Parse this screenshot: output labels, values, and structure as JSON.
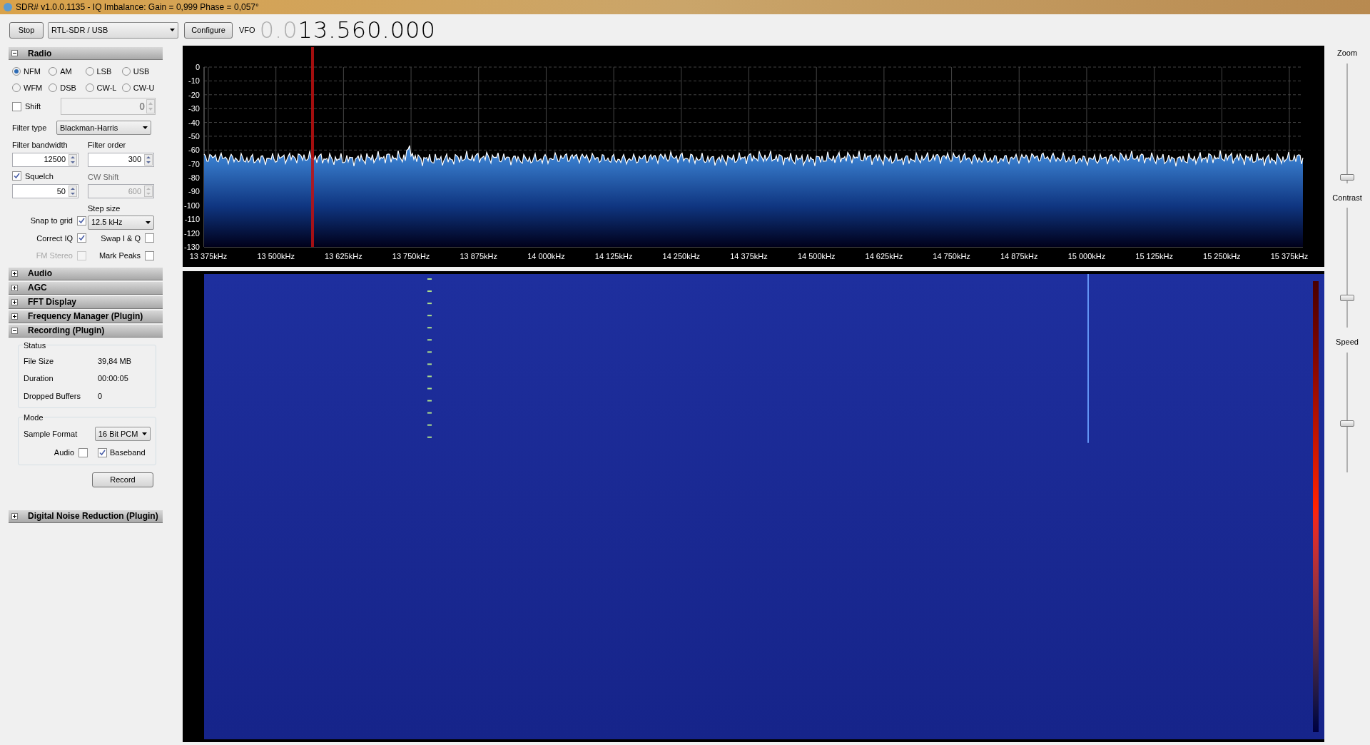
{
  "window": {
    "title": "SDR# v1.0.0.1135 - IQ Imbalance: Gain = 0,999 Phase = 0,057°"
  },
  "toolbar": {
    "stop_button": "Stop",
    "source": "RTL-SDR / USB",
    "configure_button": "Configure",
    "vfo_label": "VFO",
    "vfo_dim": "0.0",
    "vfo_value": "13.560.000"
  },
  "sections": [
    {
      "title": "Radio",
      "expanded": true,
      "kind": "radio"
    },
    {
      "title": "Audio",
      "expanded": false
    },
    {
      "title": "AGC",
      "expanded": false
    },
    {
      "title": "FFT Display",
      "expanded": false
    },
    {
      "title": "Frequency Manager (Plugin)",
      "expanded": false
    },
    {
      "title": "Recording (Plugin)",
      "expanded": true,
      "kind": "recording"
    },
    {
      "title": "Digital Noise Reduction (Plugin)",
      "expanded": false
    }
  ],
  "radio": {
    "modes": [
      {
        "label": "NFM",
        "selected": true
      },
      {
        "label": "AM",
        "selected": false
      },
      {
        "label": "LSB",
        "selected": false
      },
      {
        "label": "USB",
        "selected": false
      },
      {
        "label": "WFM",
        "selected": false
      },
      {
        "label": "DSB",
        "selected": false
      },
      {
        "label": "CW-L",
        "selected": false
      },
      {
        "label": "CW-U",
        "selected": false
      }
    ],
    "shift": {
      "label": "Shift",
      "checked": false,
      "value": "0"
    },
    "filter_type": {
      "label": "Filter type",
      "value": "Blackman-Harris"
    },
    "filter_bandwidth": {
      "label": "Filter bandwidth",
      "value": "12500"
    },
    "filter_order": {
      "label": "Filter order",
      "value": "300"
    },
    "squelch": {
      "label": "Squelch",
      "checked": true,
      "value": "50"
    },
    "cw_shift": {
      "label": "CW Shift",
      "value": "600",
      "disabled": true
    },
    "step_size": {
      "label": "Step size",
      "value": "12.5 kHz"
    },
    "left_checks": [
      {
        "label": "Snap to grid",
        "checked": true,
        "disabled": false
      },
      {
        "label": "Correct IQ",
        "checked": true,
        "disabled": false
      },
      {
        "label": "FM Stereo",
        "checked": false,
        "disabled": true
      }
    ],
    "right_checks": [
      {
        "label": "Swap I & Q",
        "checked": false,
        "disabled": false
      },
      {
        "label": "Mark Peaks",
        "checked": false,
        "disabled": false
      }
    ]
  },
  "recording": {
    "status_title": "Status",
    "status": [
      {
        "label": "File Size",
        "value": "39,84 MB"
      },
      {
        "label": "Duration",
        "value": "00:00:05"
      },
      {
        "label": "Dropped Buffers",
        "value": "0"
      }
    ],
    "mode_title": "Mode",
    "sample_format": {
      "label": "Sample Format",
      "value": "16 Bit PCM"
    },
    "audio": {
      "label": "Audio",
      "checked": false
    },
    "baseband": {
      "label": "Baseband",
      "checked": true
    },
    "record_button": "Record"
  },
  "spectrum": {
    "y_labels": [
      "0",
      "-10",
      "-20",
      "-30",
      "-40",
      "-50",
      "-60",
      "-70",
      "-80",
      "-90",
      "-100",
      "-110",
      "-120",
      "-130"
    ],
    "x_labels": [
      "13 375kHz",
      "13 500kHz",
      "13 625kHz",
      "13 750kHz",
      "13 875kHz",
      "14 000kHz",
      "14 125kHz",
      "14 250kHz",
      "14 375kHz",
      "14 500kHz",
      "14 625kHz",
      "14 750kHz",
      "14 875kHz",
      "15 000kHz",
      "15 125kHz",
      "15 250kHz",
      "15 375kHz"
    ]
  },
  "sliders": [
    {
      "label": "Zoom",
      "level": 0.02
    },
    {
      "label": "Contrast",
      "level": 0.23
    },
    {
      "label": "Speed",
      "level": 0.4
    }
  ]
}
